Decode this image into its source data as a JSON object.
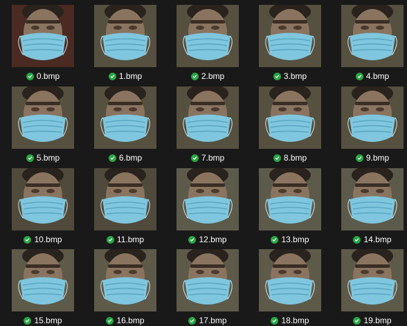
{
  "files": [
    {
      "name": "0.bmp",
      "status_icon": "check-circle-icon",
      "status_color": "#28a745",
      "thumbnail": "face-mask-thumbnail",
      "bg": "#4a2a22"
    },
    {
      "name": "1.bmp",
      "status_icon": "check-circle-icon",
      "status_color": "#28a745",
      "thumbnail": "face-mask-thumbnail",
      "bg": "#55503f"
    },
    {
      "name": "2.bmp",
      "status_icon": "check-circle-icon",
      "status_color": "#28a745",
      "thumbnail": "face-mask-thumbnail",
      "bg": "#55503f"
    },
    {
      "name": "3.bmp",
      "status_icon": "check-circle-icon",
      "status_color": "#28a745",
      "thumbnail": "face-mask-thumbnail",
      "bg": "#55503f"
    },
    {
      "name": "4.bmp",
      "status_icon": "check-circle-icon",
      "status_color": "#28a745",
      "thumbnail": "face-mask-thumbnail",
      "bg": "#55503f"
    },
    {
      "name": "5.bmp",
      "status_icon": "check-circle-icon",
      "status_color": "#28a745",
      "thumbnail": "face-mask-thumbnail",
      "bg": "#55503f"
    },
    {
      "name": "6.bmp",
      "status_icon": "check-circle-icon",
      "status_color": "#28a745",
      "thumbnail": "face-mask-thumbnail",
      "bg": "#55503f"
    },
    {
      "name": "7.bmp",
      "status_icon": "check-circle-icon",
      "status_color": "#28a745",
      "thumbnail": "face-mask-thumbnail",
      "bg": "#55503f"
    },
    {
      "name": "8.bmp",
      "status_icon": "check-circle-icon",
      "status_color": "#28a745",
      "thumbnail": "face-mask-thumbnail",
      "bg": "#55503f"
    },
    {
      "name": "9.bmp",
      "status_icon": "check-circle-icon",
      "status_color": "#28a745",
      "thumbnail": "face-mask-thumbnail",
      "bg": "#55503f"
    },
    {
      "name": "10.bmp",
      "status_icon": "check-circle-icon",
      "status_color": "#28a745",
      "thumbnail": "face-mask-thumbnail",
      "bg": "#4f4a3b"
    },
    {
      "name": "11.bmp",
      "status_icon": "check-circle-icon",
      "status_color": "#28a745",
      "thumbnail": "face-mask-thumbnail",
      "bg": "#4f4a3b"
    },
    {
      "name": "12.bmp",
      "status_icon": "check-circle-icon",
      "status_color": "#28a745",
      "thumbnail": "face-mask-thumbnail",
      "bg": "#5c5a4b"
    },
    {
      "name": "13.bmp",
      "status_icon": "check-circle-icon",
      "status_color": "#28a745",
      "thumbnail": "face-mask-thumbnail",
      "bg": "#5c5a4b"
    },
    {
      "name": "14.bmp",
      "status_icon": "check-circle-icon",
      "status_color": "#28a745",
      "thumbnail": "face-mask-thumbnail",
      "bg": "#5c5a4b"
    },
    {
      "name": "15.bmp",
      "status_icon": "check-circle-icon",
      "status_color": "#28a745",
      "thumbnail": "face-mask-thumbnail",
      "bg": "#5d5a4a"
    },
    {
      "name": "16.bmp",
      "status_icon": "check-circle-icon",
      "status_color": "#28a745",
      "thumbnail": "face-mask-thumbnail",
      "bg": "#5d5a4a"
    },
    {
      "name": "17.bmp",
      "status_icon": "check-circle-icon",
      "status_color": "#28a745",
      "thumbnail": "face-mask-thumbnail",
      "bg": "#5d5a4a"
    },
    {
      "name": "18.bmp",
      "status_icon": "check-circle-icon",
      "status_color": "#28a745",
      "thumbnail": "face-mask-thumbnail",
      "bg": "#5d5a4a"
    },
    {
      "name": "19.bmp",
      "status_icon": "check-circle-icon",
      "status_color": "#28a745",
      "thumbnail": "face-mask-thumbnail",
      "bg": "#5d5a4a"
    }
  ]
}
